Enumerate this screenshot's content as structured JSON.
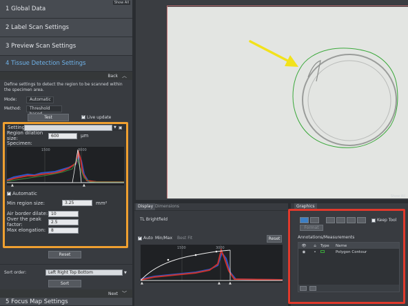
{
  "left_panel": {
    "show_all": "Show All",
    "sections": [
      {
        "label": "1  Global Data"
      },
      {
        "label": "2  Label Scan Settings"
      },
      {
        "label": "3  Preview Scan Settings"
      },
      {
        "label": "4  Tissue Detection Settings"
      },
      {
        "label": "5  Focus Map Settings"
      }
    ],
    "back_label": "Back",
    "next_label": "Next",
    "description": "Define settings to detect the region to be scanned within the specimen area.",
    "mode_label": "Mode:",
    "mode_value": "Automatic",
    "method_label": "Method:",
    "method_value": "Threshold based",
    "test_button": "Test",
    "live_update_label": "Live update",
    "live_update_checked": true,
    "settings": {
      "title": "Settings",
      "region_dilation_label": "Region dilation size:",
      "region_dilation_value": "600",
      "region_dilation_unit": "µm",
      "specimen_label": "Specimen:",
      "hist_ticks": [
        "1500",
        "3000"
      ],
      "automatic_label": "Automatic",
      "automatic_checked": true,
      "min_region_label": "Min region size:",
      "min_region_value": "3.25",
      "min_region_unit": "mm²",
      "air_border_label": "Air border dilate:",
      "air_border_value": "10",
      "peak_factor_label": "Over the peak factor:",
      "peak_factor_value": "2.5",
      "max_elong_label": "Max elongation:",
      "max_elong_value": "8",
      "reset_button": "Reset"
    },
    "sort_order_label": "Sort order:",
    "sort_order_value": "Left Right Top Bottom",
    "sort_button": "Sort"
  },
  "viewer": {
    "show_all": "Show All"
  },
  "display_panel": {
    "tab_display": "Display",
    "tab_dimensions": "Dimensions",
    "channel_name": "TL Brightfield",
    "auto_label": "Auto",
    "auto_checked": true,
    "min_max_label": "Min/Max",
    "best_fit_label": "Best Fit",
    "reset_button": "Reset",
    "hist_ticks": [
      "1500",
      "3000"
    ]
  },
  "graphics_panel": {
    "tab_graphics": "Graphics",
    "keep_tool_label": "Keep Tool",
    "format_button": "Format",
    "annotations_title": "Annotations/Measurements",
    "columns": [
      "Type",
      "Name"
    ],
    "rows": [
      {
        "name": "Polygon Contour"
      }
    ],
    "colors": {
      "contour": "#3aa83a"
    }
  },
  "colors": {
    "accent_blue": "#6fb3ea",
    "highlight_orange": "#f0a030",
    "highlight_red": "#e0392c",
    "arrow_yellow": "#f2e21b"
  }
}
